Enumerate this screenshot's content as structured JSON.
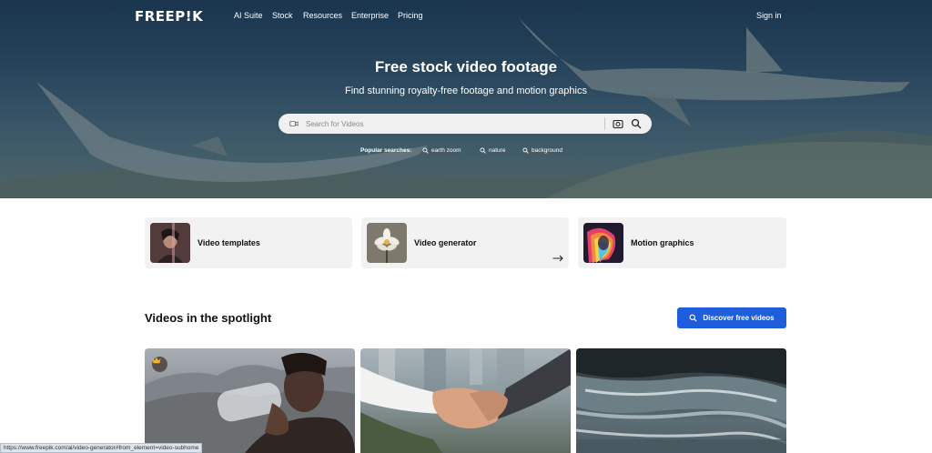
{
  "nav": {
    "logo": "FREEP!K",
    "links": [
      "AI Suite",
      "Stock",
      "Resources",
      "Enterprise",
      "Pricing"
    ],
    "signin": "Sign in"
  },
  "hero": {
    "title": "Free stock video footage",
    "subtitle": "Find stunning royalty-free footage and motion graphics",
    "search_placeholder": "Search for Videos",
    "popular_label": "Popular searches:",
    "popular": [
      "earth zoom",
      "nature",
      "background"
    ]
  },
  "cards": [
    {
      "label": "Video templates",
      "icon": "portrait-thumbnail"
    },
    {
      "label": "Video generator",
      "icon": "flower-thumbnail"
    },
    {
      "label": "Motion graphics",
      "icon": "rainbow-portrait-thumbnail"
    }
  ],
  "spotlight": {
    "title": "Videos in the spotlight",
    "button": "Discover free videos"
  },
  "videos": [
    {
      "subject": "man-drinking-water",
      "premium": true
    },
    {
      "subject": "handshake",
      "premium": false
    },
    {
      "subject": "river-water",
      "premium": false
    }
  ],
  "status_url": "https://www.freepik.com/ai/video-generator#from_element=video-subhome",
  "colors": {
    "accent": "#1e5ddb",
    "card_bg": "#f2f2f2",
    "hero_overlay": "#2b4d68"
  }
}
